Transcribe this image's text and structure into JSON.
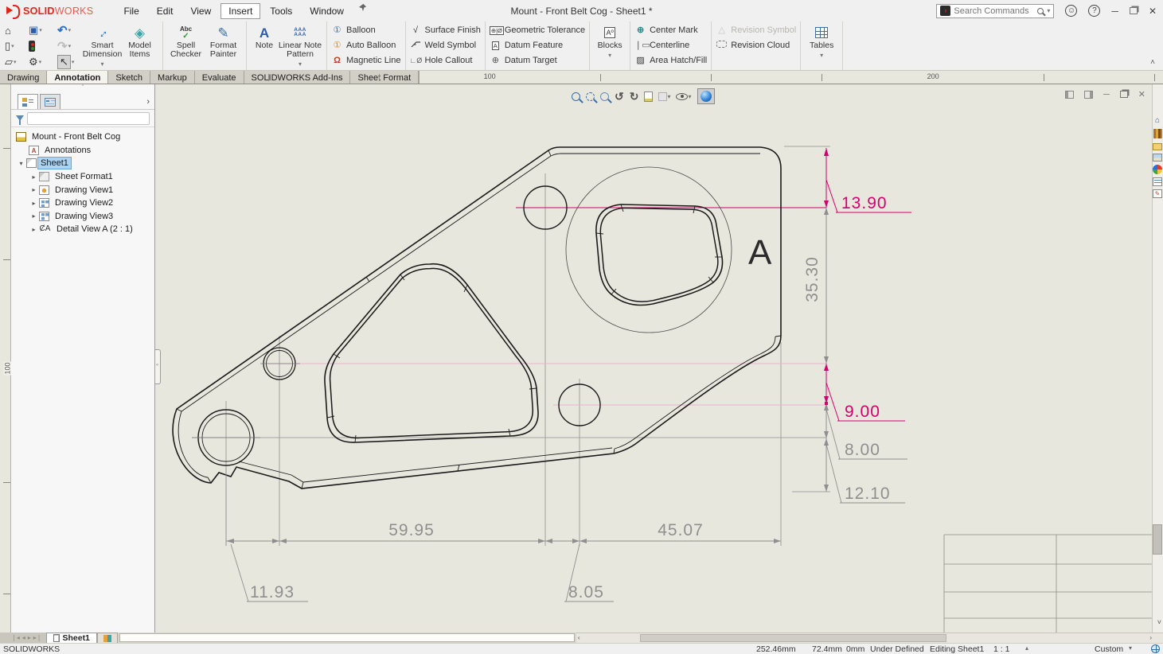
{
  "title_bar": {
    "logo_solid": "SOLID",
    "logo_works": "WORKS",
    "menus": [
      "File",
      "Edit",
      "View",
      "Insert",
      "Tools",
      "Window"
    ],
    "active_menu": "Insert",
    "document_title": "Mount - Front Belt Cog - Sheet1 *",
    "search_placeholder": "Search Commands",
    "help_glyph": "?",
    "minimize_glyph": "─",
    "close_glyph": "✕"
  },
  "ribbon": {
    "smart_dimension": "Smart Dimension",
    "model_items": "Model Items",
    "spell_checker": "Spell Checker",
    "format_painter": "Format Painter",
    "note": "Note",
    "linear_note_pattern": "Linear Note Pattern",
    "balloon": "Balloon",
    "auto_balloon": "Auto Balloon",
    "magnetic_line": "Magnetic Line",
    "surface_finish": "Surface Finish",
    "weld_symbol": "Weld Symbol",
    "hole_callout": "Hole Callout",
    "geometric_tolerance": "Geometric Tolerance",
    "datum_feature": "Datum Feature",
    "datum_target": "Datum Target",
    "blocks": "Blocks",
    "center_mark": "Center Mark",
    "centerline": "Centerline",
    "area_hatch_fill": "Area Hatch/Fill",
    "revision_symbol": "Revision Symbol",
    "revision_cloud": "Revision Cloud",
    "tables": "Tables"
  },
  "command_tabs": [
    "Drawing",
    "Annotation",
    "Sketch",
    "Markup",
    "Evaluate",
    "SOLIDWORKS Add-Ins",
    "Sheet Format"
  ],
  "active_command_tab": "Annotation",
  "ruler": {
    "h_label_1": "100",
    "h_label_2": "200",
    "v_label": "100"
  },
  "feature_tree": {
    "root": "Mount - Front Belt Cog",
    "annotations": "Annotations",
    "sheet1": "Sheet1",
    "sheet_format1": "Sheet Format1",
    "drawing_view1": "Drawing View1",
    "drawing_view2": "Drawing View2",
    "drawing_view3": "Drawing View3",
    "detail_view_a": "Detail View A (2 : 1)"
  },
  "drawing": {
    "detail_label": "A",
    "dims": {
      "d1390": "13.90",
      "d3530": "35.30",
      "d900": "9.00",
      "d800": "8.00",
      "d1210": "12.10",
      "d5995": "59.95",
      "d4507": "45.07",
      "d1193": "11.93",
      "d805": "8.05"
    },
    "colors": {
      "selected_dimension": "#d4006e",
      "dimension_gray": "#8f8f8f",
      "highlight_pink": "#eab6d2",
      "part_line": "#1a1a1a",
      "sheet_background": "#e8e7de"
    }
  },
  "sheet_tabs": {
    "active": "Sheet1"
  },
  "status_bar": {
    "app_name": "SOLIDWORKS",
    "coord_x": "252.46mm",
    "coord_y": "72.4mm",
    "coord_z": "0mm",
    "state": "Under Defined",
    "editing": "Editing Sheet1",
    "scale": "1 : 1",
    "units": "Custom"
  }
}
